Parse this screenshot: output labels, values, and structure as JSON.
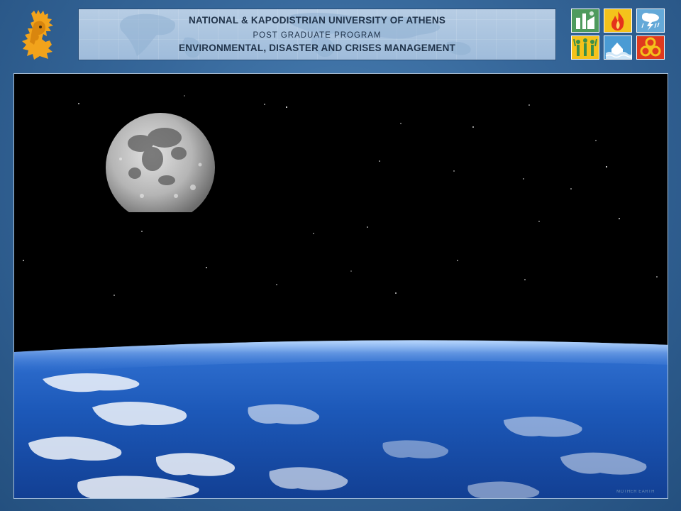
{
  "header": {
    "line1": "NATIONAL & KAPODISTRIAN UNIVERSITY OF ATHENS",
    "line2": "POST  GRADUATE   PROGRAM",
    "line3": "ENVIRONMENTAL, DISASTER AND CRISES MANAGEMENT"
  },
  "logo": {
    "icon": "athena-head-icon",
    "color": "#f2a31b"
  },
  "hazard_icons": [
    {
      "name": "industrial-hazard-icon",
      "bg": "#4e9a5d"
    },
    {
      "name": "fire-icon",
      "bg": "#f4c21b"
    },
    {
      "name": "storm-icon",
      "bg": "#64a9d8"
    },
    {
      "name": "people-icon",
      "bg": "#f4c21b"
    },
    {
      "name": "flood-icon",
      "bg": "#4a9bd4"
    },
    {
      "name": "biohazard-icon",
      "bg": "#e03a1e"
    }
  ],
  "photo": {
    "alt": "Moon above Earth from space",
    "credit": "MOTHER EARTH"
  }
}
